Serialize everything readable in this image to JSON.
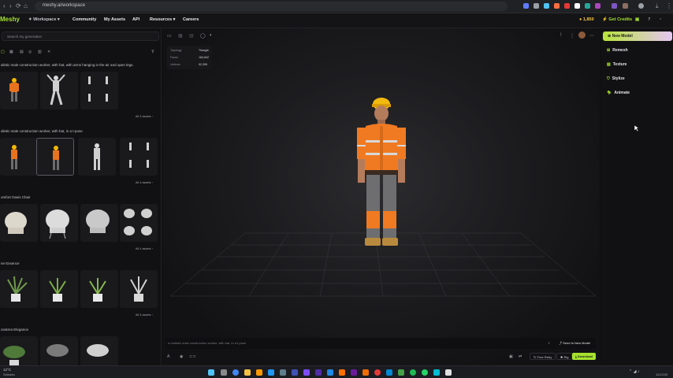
{
  "browser": {
    "url": "meshy.ai/workspace"
  },
  "header": {
    "logo": "Meshy",
    "nav": [
      "Workspace",
      "Community",
      "My Assets",
      "API",
      "Resources",
      "Careers"
    ],
    "credits": "1,850",
    "get_credits": "Get Credits"
  },
  "left": {
    "search_placeholder": "Search my generation",
    "groups": [
      {
        "prompt": "alistic male construction worker, with hat, with arms hanging in the air and open legs.",
        "all": "All 3 assets"
      },
      {
        "prompt": "alistic male construction worker, with hat, in a t-pose",
        "all": "All 4 assets"
      },
      {
        "prompt": "omfort Oasis Chair",
        "all": "All 4 assets"
      },
      {
        "prompt": "ne Essence",
        "all": "All 5 assets"
      },
      {
        "prompt": "onstera Elegance",
        "all": ""
      }
    ]
  },
  "viewport": {
    "stats": {
      "topology_label": "Topology",
      "topology_value": "Triangle",
      "faces_label": "Faces",
      "faces_value": "184,842",
      "vertices_label": "Vertices",
      "vertices_value": "92,395"
    },
    "prompt_text": "a realistic male construction worker, with hat, in a t-pose",
    "send_to_new_model": "Send to New Model",
    "free_retry": "Free Retry",
    "rig": "Rig",
    "download": "Download"
  },
  "right": {
    "items": [
      "New Model",
      "Remesh",
      "Texture",
      "Stylize",
      "Animate"
    ]
  },
  "taskbar": {
    "temp": "12°C",
    "weather": "Soleado",
    "time": "",
    "date": "11/12/20"
  },
  "colors": {
    "accent": "#a6e22e",
    "bg": "#0e0e10"
  }
}
